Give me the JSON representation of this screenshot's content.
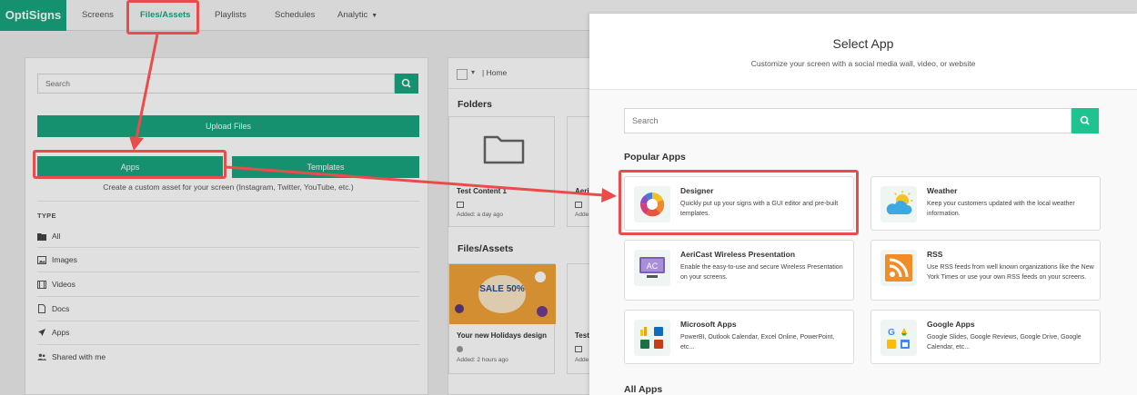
{
  "navbar": {
    "brand": "OptiSigns",
    "items": [
      {
        "label": "Screens"
      },
      {
        "label": "Files/Assets"
      },
      {
        "label": "Playlists"
      },
      {
        "label": "Schedules"
      },
      {
        "label": "Analytic"
      }
    ]
  },
  "left_panel": {
    "search_placeholder": "Search",
    "upload_label": "Upload Files",
    "apps_label": "Apps",
    "templates_label": "Templates",
    "hint": "Create a custom asset for your screen (Instagram, Twitter, YouTube, etc.)",
    "type_heading": "TYPE",
    "types": [
      {
        "label": "All",
        "icon": "folder-icon"
      },
      {
        "label": "Images",
        "icon": "image-icon"
      },
      {
        "label": "Videos",
        "icon": "film-icon"
      },
      {
        "label": "Docs",
        "icon": "doc-icon"
      },
      {
        "label": "Apps",
        "icon": "rocket-icon"
      },
      {
        "label": "Shared with me",
        "icon": "users-icon"
      }
    ]
  },
  "mid_panel": {
    "breadcrumb": "Home",
    "folders_title": "Folders",
    "folder_cards": [
      {
        "name": "Test Content 1",
        "added": "Added: a day ago"
      },
      {
        "name": "Aeri",
        "added": "Adde"
      }
    ],
    "files_title": "Files/Assets",
    "file_cards": [
      {
        "name": "Your new Holidays design",
        "added": "Added: 2 hours ago",
        "thumb_text": "SALE 50%"
      },
      {
        "name": "Test",
        "added": "Adde"
      }
    ]
  },
  "modal": {
    "title": "Select App",
    "subtitle": "Customize your screen with a social media wall, video, or website",
    "search_placeholder": "Search",
    "popular_title": "Popular Apps",
    "apps": [
      {
        "name": "Designer",
        "desc": "Quickly put up your signs with a GUI editor and pre-built templates.",
        "icon": "designer-color-wheel-icon"
      },
      {
        "name": "Weather",
        "desc": "Keep your customers updated with the local weather information.",
        "icon": "weather-sun-cloud-icon"
      },
      {
        "name": "AeriCast Wireless Presentation",
        "desc": "Enable the easy-to-use and secure Wireless Presentation on your screens.",
        "icon": "aericast-monitor-icon"
      },
      {
        "name": "RSS",
        "desc": "Use RSS feeds from well known organizations like the New York Times or use your own RSS feeds on your screens.",
        "icon": "rss-icon"
      },
      {
        "name": "Microsoft Apps",
        "desc": "PowerBI, Outlook Calendar, Excel Online, PowerPoint, etc...",
        "icon": "microsoft-apps-icon"
      },
      {
        "name": "Google Apps",
        "desc": "Google Slides, Google Reviews, Google Drive, Google Calendar, etc...",
        "icon": "google-apps-icon"
      }
    ],
    "all_title": "All Apps"
  },
  "colors": {
    "brand_green": "#1aa67f",
    "annotation_red": "#ea4b4b"
  }
}
